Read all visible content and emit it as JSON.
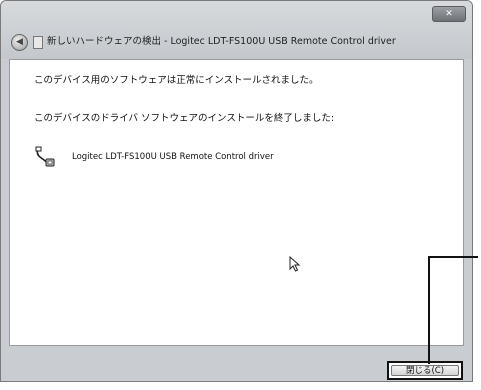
{
  "window": {
    "title": "新しいハードウェアの検出 - Logitec LDT-FS100U USB Remote Control driver",
    "close_glyph": "✕"
  },
  "content": {
    "message_installed": "このデバイス用のソフトウェアは正常にインストールされました。",
    "message_finished": "このデバイスのドライバ ソフトウェアのインストールを終了しました:",
    "device_name": "Logitec LDT-FS100U USB Remote Control driver",
    "device_icon": "usb-cable-icon"
  },
  "footer": {
    "close_label": "閉じる(C)"
  }
}
